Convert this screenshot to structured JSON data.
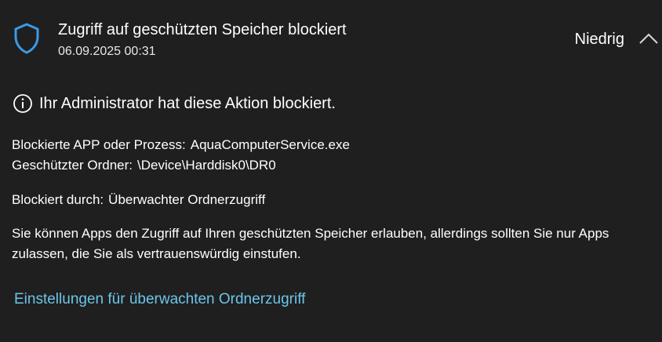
{
  "notification": {
    "icon": "shield-icon",
    "title": "Zugriff auf geschützten Speicher blockiert",
    "timestamp": "06.09.2025 00:31",
    "severity": "Niedrig",
    "collapse_icon": "chevron-up-icon"
  },
  "message": {
    "icon": "info-icon",
    "text": "Ihr Administrator hat diese Aktion blockiert."
  },
  "details": {
    "app_label": "Blockierte APP oder Prozess:",
    "app_value": "AquaComputerService.exe",
    "folder_label": "Geschützter Ordner:",
    "folder_value": "\\Device\\Harddisk0\\DR0",
    "blocked_by_label": "Blockiert durch:",
    "blocked_by_value": "Überwachter Ordnerzugriff"
  },
  "description": "Sie können Apps den Zugriff auf Ihren geschützten Speicher erlauben, allerdings sollten Sie nur Apps zulassen, die Sie als vertrauenswürdig einstufen.",
  "link": {
    "label": "Einstellungen für überwachten Ordnerzugriff"
  },
  "colors": {
    "background": "#1f1f1f",
    "accent": "#3b9ae6",
    "link": "#6cc5ea"
  }
}
